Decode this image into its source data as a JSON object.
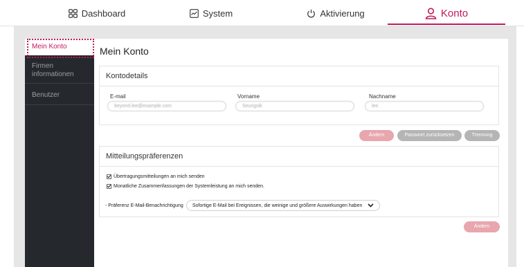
{
  "nav": {
    "tabs": [
      {
        "label": "Dashboard",
        "icon": "grid-icon"
      },
      {
        "label": "System",
        "icon": "chart-icon"
      },
      {
        "label": "Aktivierung",
        "icon": "power-icon"
      },
      {
        "label": "Konto",
        "icon": "user-icon"
      }
    ],
    "active_color": "#c2185b"
  },
  "sidebar": {
    "items": [
      {
        "label": "Mein Konto",
        "active": true
      },
      {
        "label": "Firmen informationen",
        "active": false
      },
      {
        "label": "Benutzer",
        "active": false
      }
    ]
  },
  "main": {
    "title": "Mein Konto",
    "account": {
      "heading": "Kontodetails",
      "fields": [
        {
          "label": "E-mail",
          "value": "beyond.lee@example.com"
        },
        {
          "label": "Vorname",
          "value": "Seungsik"
        },
        {
          "label": "Nachname",
          "value": "lee"
        }
      ],
      "buttons": {
        "change": "Ändern",
        "reset_password": "Passwort zurücksetzen",
        "disconnect": "Trennung"
      }
    },
    "notifications": {
      "heading": "Mitteilungspräferenzen",
      "options": [
        {
          "label": "Übertragungsmitteilungen an mich senden",
          "checked": true
        },
        {
          "label": "Monatliche Zusammenfassungen der Systemleistung an mich senden.",
          "checked": true
        }
      ],
      "email_pref_label": "- Präferenz E-Mail-Benachrichtigung",
      "email_pref_value": "Sofortige E-Mail bei Ereignissen, die weinige und größere Auswirkungen haben",
      "change_button": "Ändern"
    }
  }
}
